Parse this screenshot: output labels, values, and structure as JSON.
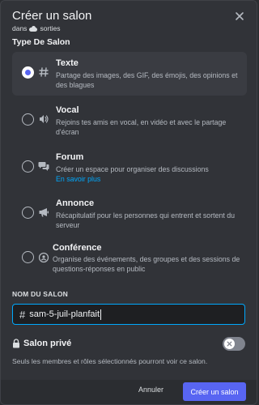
{
  "modal": {
    "title": "Créer un salon",
    "subtitle_prefix": "dans",
    "subtitle_category": "sorties",
    "close_icon": "close-icon"
  },
  "channel_type": {
    "label": "Type De Salon",
    "options": [
      {
        "title": "Texte",
        "description": "Partage des images, des GIF, des émojis, des opinions et des blagues",
        "icon": "hash-icon",
        "selected": true
      },
      {
        "title": "Vocal",
        "description": "Rejoins tes amis en vocal, en vidéo et avec le partage d'écran",
        "icon": "speaker-icon",
        "selected": false
      },
      {
        "title": "Forum",
        "description": "Créer un espace pour organiser des discussions",
        "link": "En savoir plus",
        "icon": "forum-icon",
        "selected": false
      },
      {
        "title": "Annonce",
        "description": "Récapitulatif pour les personnes qui entrent et sortent du serveur",
        "icon": "megaphone-icon",
        "selected": false
      },
      {
        "title": "Conférence",
        "description": "Organise des événements, des groupes et des sessions de questions-réponses en public",
        "icon": "stage-icon",
        "selected": false
      }
    ]
  },
  "channel_name": {
    "label": "NOM DU SALON",
    "prefix": "#",
    "value": "sam-5-juil-planfait"
  },
  "private": {
    "label": "Salon privé",
    "description": "Seuls les membres et rôles sélectionnés pourront voir ce salon.",
    "enabled": false
  },
  "footer": {
    "cancel_label": "Annuler",
    "create_label": "Créer un salon"
  },
  "colors": {
    "background": "#313338",
    "accent": "#5865f2",
    "link": "#00a8fc"
  }
}
